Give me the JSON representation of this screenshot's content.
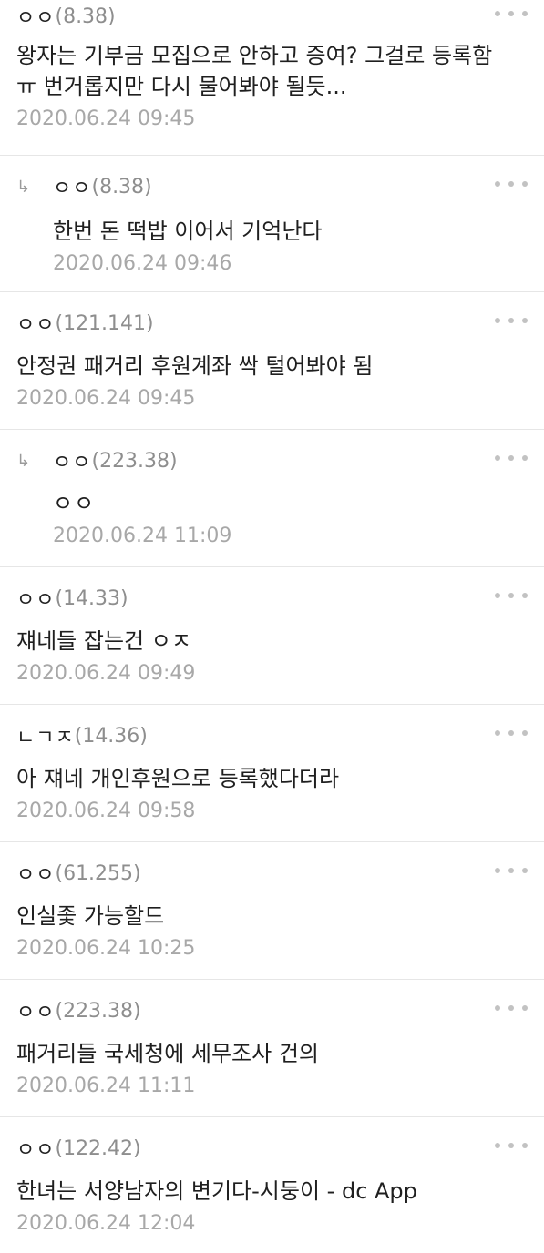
{
  "comments": [
    {
      "author": "ㅇㅇ",
      "ip": "(8.38)",
      "text": "왕자는 기부금 모집으로 안하고 증여? 그걸로 등록함 ㅠ 번거롭지만 다시 물어봐야 될듯...",
      "date": "2020.06.24 09:45",
      "reply": false
    },
    {
      "author": "ㅇㅇ",
      "ip": "(8.38)",
      "text": "한번 돈 떡밥 이어서 기억난다",
      "date": "2020.06.24 09:46",
      "reply": true
    },
    {
      "author": "ㅇㅇ",
      "ip": "(121.141)",
      "text": "안정권 패거리 후원계좌 싹 털어봐야 됨",
      "date": "2020.06.24 09:45",
      "reply": false
    },
    {
      "author": "ㅇㅇ",
      "ip": "(223.38)",
      "text": "ㅇㅇ",
      "date": "2020.06.24 11:09",
      "reply": true
    },
    {
      "author": "ㅇㅇ",
      "ip": "(14.33)",
      "text": "쟤네들 잡는건 ㅇㅈ",
      "date": "2020.06.24 09:49",
      "reply": false
    },
    {
      "author": "ㄴㄱㅈ",
      "ip": "(14.36)",
      "text": "아 쟤네 개인후원으로 등록했다더라",
      "date": "2020.06.24 09:58",
      "reply": false
    },
    {
      "author": "ㅇㅇ",
      "ip": "(61.255)",
      "text": "인실좇 가능할드",
      "date": "2020.06.24 10:25",
      "reply": false
    },
    {
      "author": "ㅇㅇ",
      "ip": "(223.38)",
      "text": "패거리들 국세청에 세무조사 건의",
      "date": "2020.06.24 11:11",
      "reply": false
    },
    {
      "author": "ㅇㅇ",
      "ip": "(122.42)",
      "text": "한녀는 서양남자의 변기다-시둥이 - dc App",
      "date": "2020.06.24 12:04",
      "reply": false
    }
  ],
  "reply_arrow": "↳",
  "more_icon": "more-dots-icon"
}
